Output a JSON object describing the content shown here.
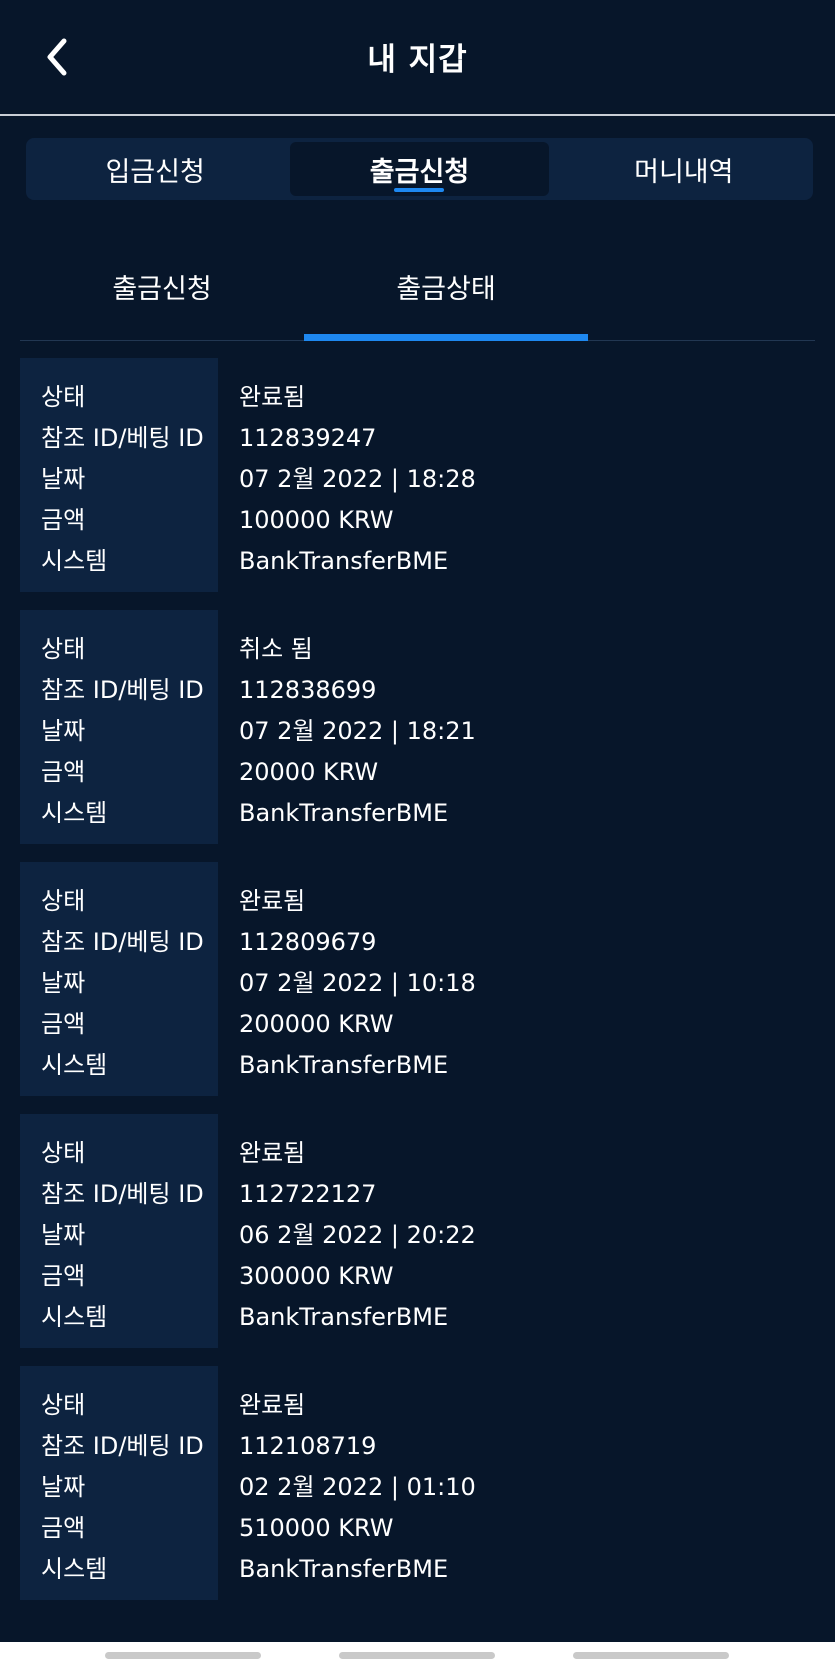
{
  "header": {
    "title": "내 지갑",
    "back_icon": "chevron-left-icon"
  },
  "tabs": [
    {
      "label": "입금신청",
      "active": false
    },
    {
      "label": "출금신청",
      "active": true
    },
    {
      "label": "머니내역",
      "active": false
    }
  ],
  "subtabs": [
    {
      "label": "출금신청",
      "active": false
    },
    {
      "label": "출금상태",
      "active": true
    }
  ],
  "field_labels": {
    "status": "상태",
    "ref_id": "참조 ID/베팅 ID",
    "date": "날짜",
    "amount": "금액",
    "system": "시스템"
  },
  "transactions": [
    {
      "status": "완료됨",
      "ref_id": "112839247",
      "date": "07 2월 2022 | 18:28",
      "amount": "100000 KRW",
      "system": "BankTransferBME"
    },
    {
      "status": "취소 됨",
      "ref_id": "112838699",
      "date": "07 2월 2022 | 18:21",
      "amount": "20000 KRW",
      "system": "BankTransferBME"
    },
    {
      "status": "완료됨",
      "ref_id": "112809679",
      "date": "07 2월 2022 | 10:18",
      "amount": "200000 KRW",
      "system": "BankTransferBME"
    },
    {
      "status": "완료됨",
      "ref_id": "112722127",
      "date": "06 2월 2022 | 20:22",
      "amount": "300000 KRW",
      "system": "BankTransferBME"
    },
    {
      "status": "완료됨",
      "ref_id": "112108719",
      "date": "02 2월 2022 | 01:10",
      "amount": "510000 KRW",
      "system": "BankTransferBME"
    }
  ],
  "colors": {
    "background": "#07162a",
    "panel": "#0d2340",
    "accent": "#1e88f0"
  }
}
